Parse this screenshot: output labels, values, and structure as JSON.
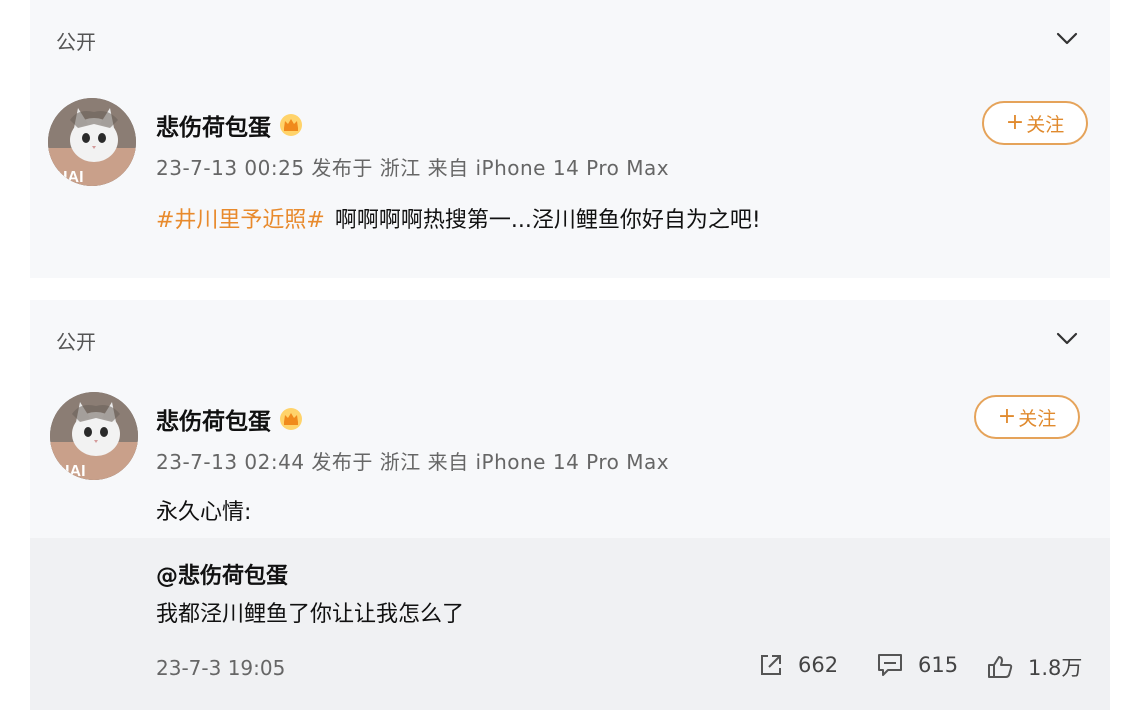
{
  "posts": [
    {
      "visibility": "公开",
      "username": "悲伤荷包蛋",
      "meta": "23-7-13 00:25 发布于 浙江 来自 iPhone 14 Pro Max",
      "follow_label": "关注",
      "hashtag": "#井川里予近照#",
      "content": "啊啊啊啊热搜第一...泾川鲤鱼你好自为之吧!"
    },
    {
      "visibility": "公开",
      "username": "悲伤荷包蛋",
      "meta": "23-7-13 02:44 发布于 浙江 来自 iPhone 14 Pro Max",
      "follow_label": "关注",
      "content": "永久心情:",
      "repost": {
        "user": "@悲伤荷包蛋",
        "text": "我都泾川鲤鱼了你让让我怎么了",
        "date": "23-7-3 19:05",
        "shares": "662",
        "comments": "615",
        "likes": "1.8万"
      }
    }
  ],
  "colors": {
    "accent": "#e88a2c",
    "card_bg": "#f7f8fa",
    "repost_bg": "#f0f1f3"
  }
}
